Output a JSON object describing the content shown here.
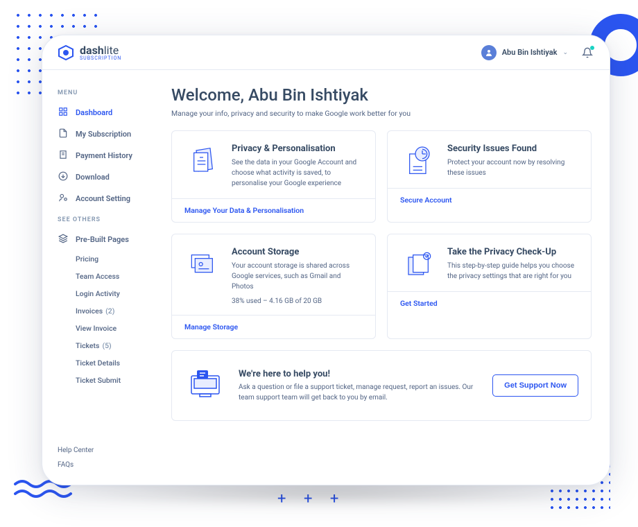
{
  "brand": {
    "name_bold": "dash",
    "name_light": "lite",
    "subtitle": "SUBSCRIPTION"
  },
  "user": {
    "name": "Abu Bin Ishtiyak"
  },
  "sidebar": {
    "menu_label": "MENU",
    "items": [
      {
        "label": "Dashboard",
        "icon": "grid"
      },
      {
        "label": "My Subscription",
        "icon": "file"
      },
      {
        "label": "Payment History",
        "icon": "receipt"
      },
      {
        "label": "Download",
        "icon": "download"
      },
      {
        "label": "Account Setting",
        "icon": "user-cog"
      }
    ],
    "others_label": "SEE OTHERS",
    "prebuilt_label": "Pre-Built Pages",
    "subpages": [
      {
        "label": "Pricing"
      },
      {
        "label": "Team Access"
      },
      {
        "label": "Login Activity"
      },
      {
        "label": "Invoices",
        "count": "(2)"
      },
      {
        "label": "View Invoice"
      },
      {
        "label": "Tickets",
        "count": "(5)"
      },
      {
        "label": "Ticket Details"
      },
      {
        "label": "Ticket Submit"
      }
    ],
    "footer": {
      "help": "Help Center",
      "faqs": "FAQs"
    }
  },
  "page": {
    "title": "Welcome, Abu Bin Ishtiyak",
    "subtitle": "Manage your info, privacy and security to make Google work better for you"
  },
  "cards": [
    {
      "title": "Privacy & Personalisation",
      "text": "See the data in your Google Account and choose what activity is saved, to personalise your Google experience",
      "action": "Manage Your Data & Personalisation"
    },
    {
      "title": "Security Issues Found",
      "text": "Protect your account now by resolving these issues",
      "action": "Secure Account"
    },
    {
      "title": "Account Storage",
      "text": "Your account storage is shared across Google services, such as Gmail and Photos",
      "meta": "38% used – 4.16 GB of 20 GB",
      "action": "Manage Storage"
    },
    {
      "title": "Take the Privacy Check-Up",
      "text": "This step-by-step guide helps you choose the privacy settings that are right for you",
      "action": "Get Started"
    }
  ],
  "help": {
    "title": "We're here to help you!",
    "text": "Ask a question or file a support ticket, manage request, report an issues. Our team support team will get back to you by email.",
    "button": "Get Support Now"
  }
}
